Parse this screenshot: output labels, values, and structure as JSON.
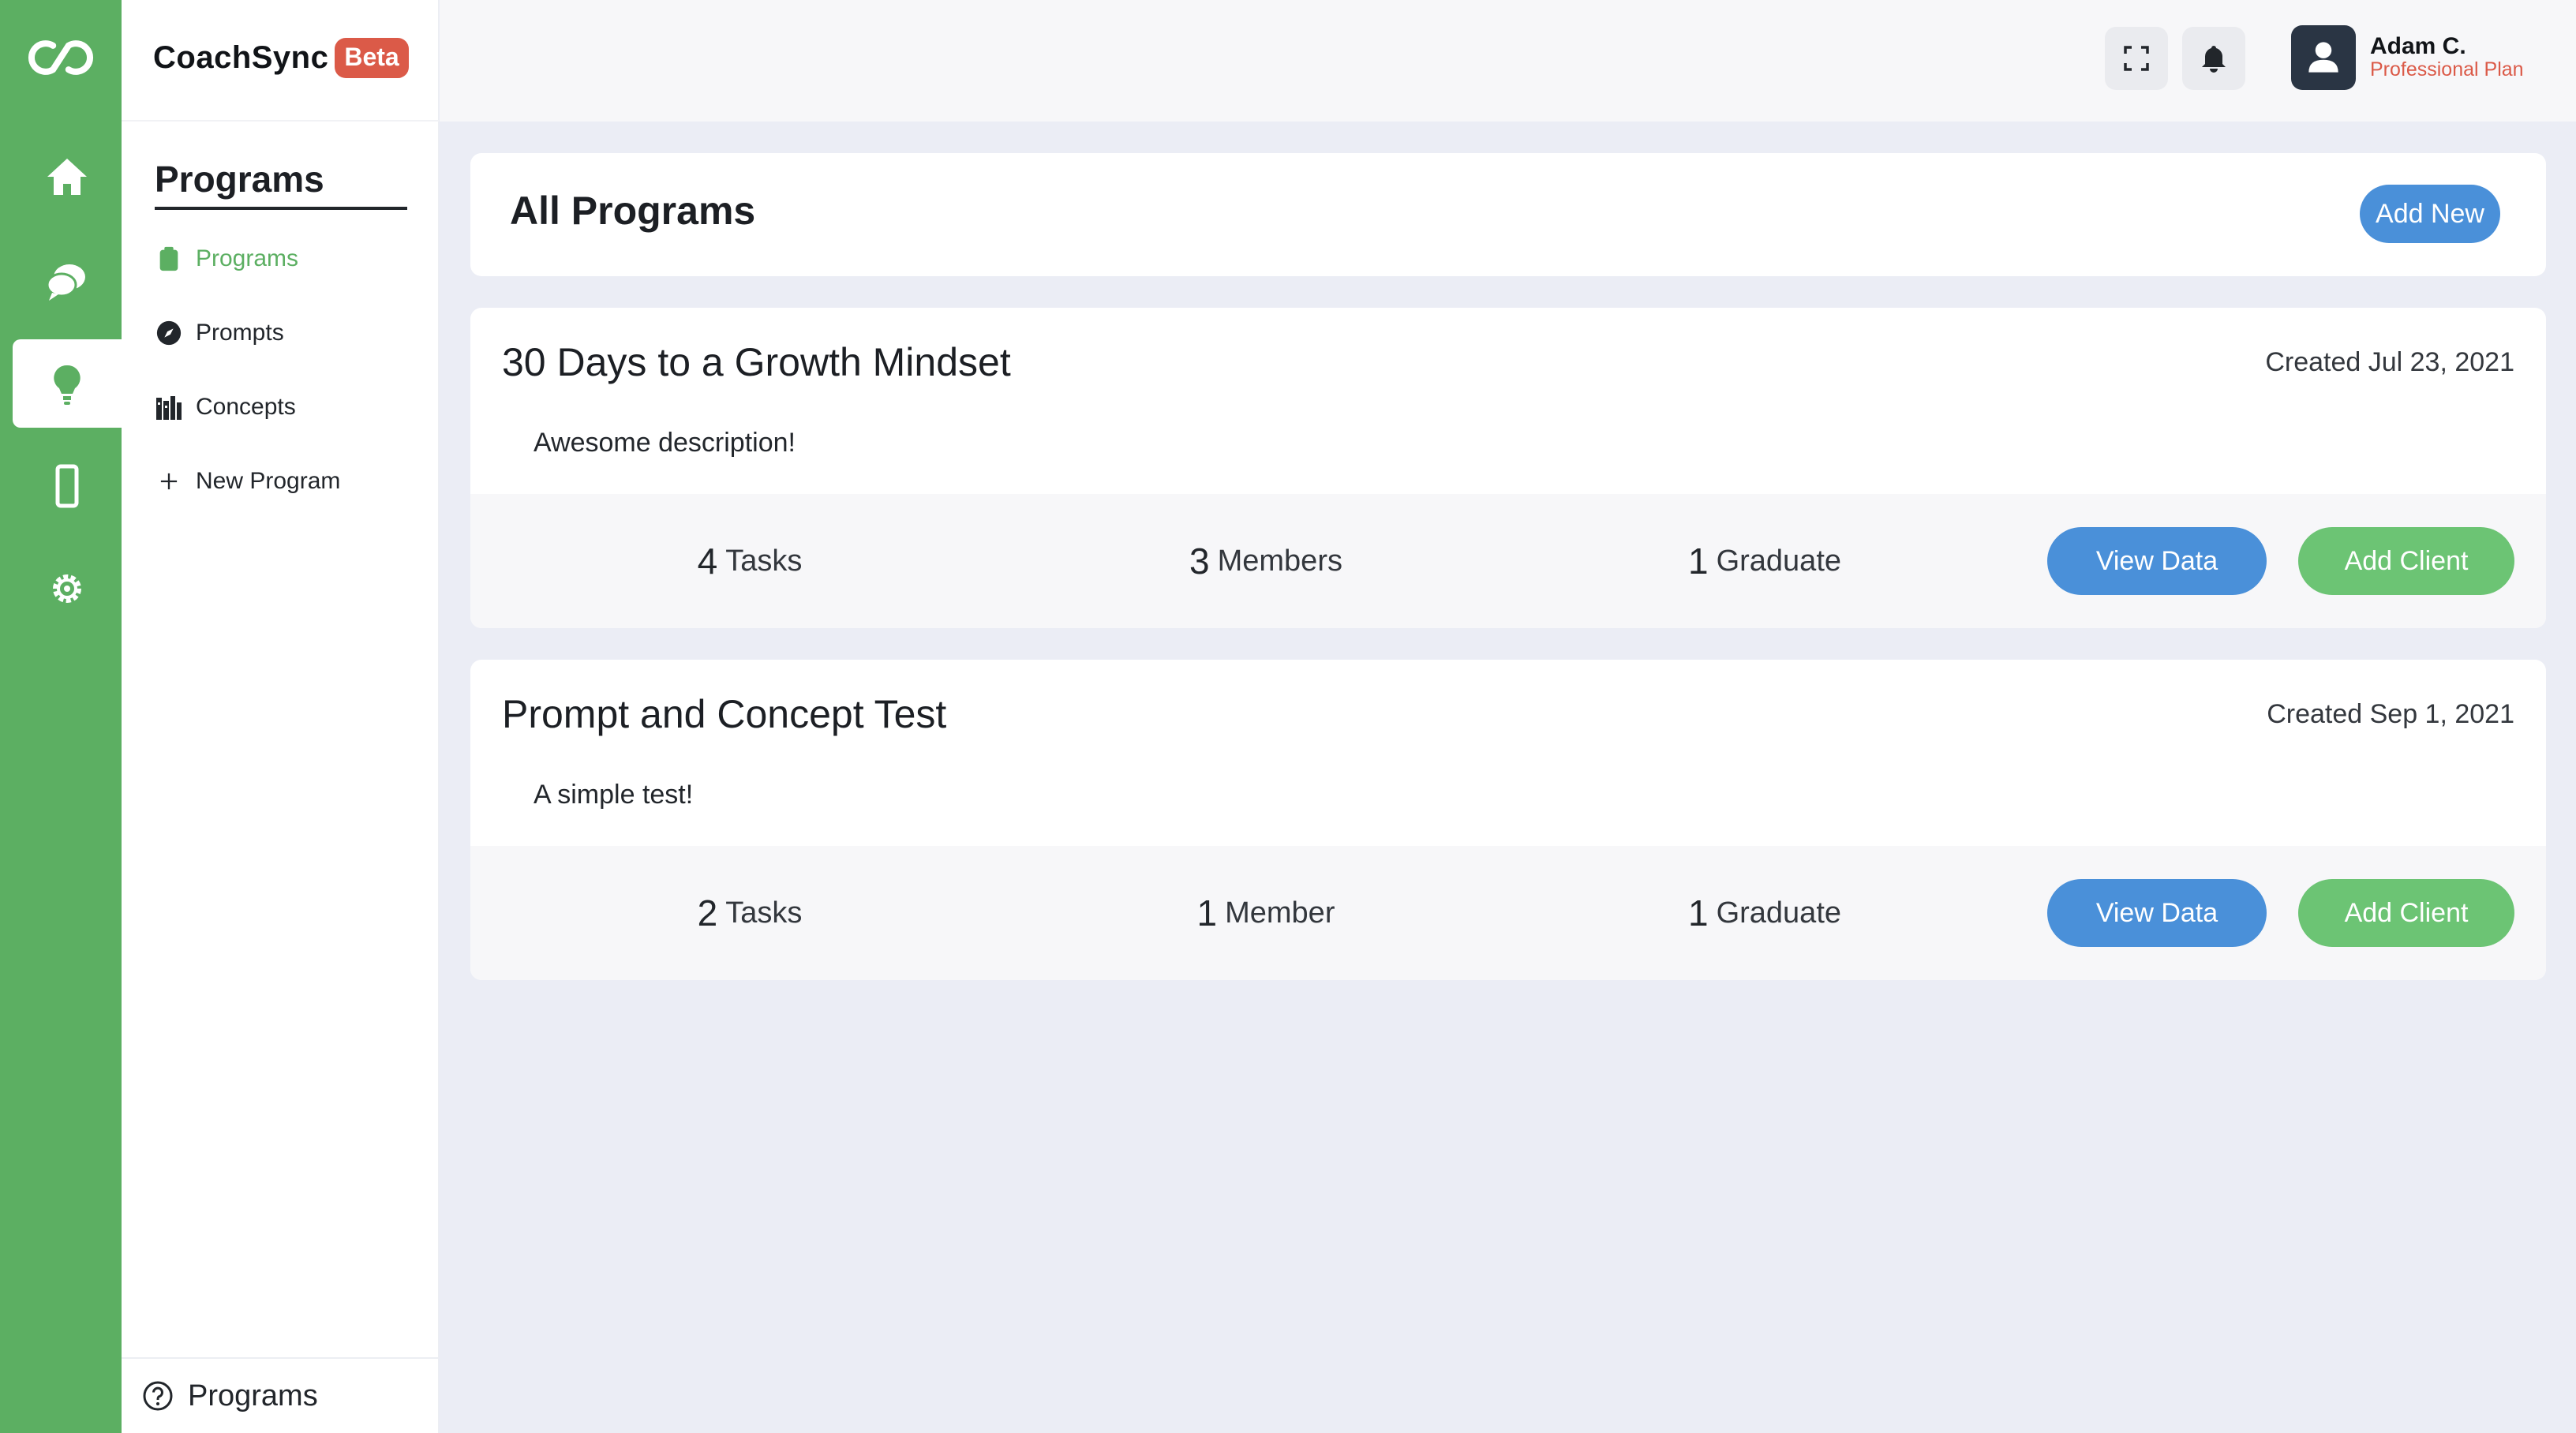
{
  "app": {
    "brand": "CoachSync",
    "badge": "Beta"
  },
  "rail": {
    "items": [
      {
        "icon": "home-icon"
      },
      {
        "icon": "chat-icon"
      },
      {
        "icon": "lightbulb-icon",
        "active": true
      },
      {
        "icon": "mobile-icon"
      },
      {
        "icon": "gear-icon"
      }
    ]
  },
  "sidebar": {
    "title": "Programs",
    "items": [
      {
        "label": "Programs",
        "icon": "clipboard-icon",
        "active": true
      },
      {
        "label": "Prompts",
        "icon": "compass-icon"
      },
      {
        "label": "Concepts",
        "icon": "books-icon"
      },
      {
        "label": "New Program",
        "icon": "plus-icon"
      }
    ],
    "footer_label": "Programs"
  },
  "topbar": {
    "user_name": "Adam C.",
    "user_plan": "Professional Plan"
  },
  "main": {
    "title": "All Programs",
    "add_new_label": "Add New",
    "programs": [
      {
        "title": "30 Days to a Growth Mindset",
        "created": "Created Jul 23, 2021",
        "description": "Awesome description!",
        "tasks_num": "4",
        "tasks_label": "Tasks",
        "members_num": "3",
        "members_label": "Members",
        "graduates_num": "1",
        "graduates_label": "Graduate",
        "view_label": "View Data",
        "add_label": "Add Client"
      },
      {
        "title": "Prompt and Concept Test",
        "created": "Created Sep 1, 2021",
        "description": "A simple test!",
        "tasks_num": "2",
        "tasks_label": "Tasks",
        "members_num": "1",
        "members_label": "Member",
        "graduates_num": "1",
        "graduates_label": "Graduate",
        "view_label": "View Data",
        "add_label": "Add Client"
      }
    ]
  },
  "colors": {
    "rail_green": "#5caf62",
    "accent_blue": "#4a90d9",
    "button_green": "#6cc474",
    "beta_red": "#db5a48"
  }
}
